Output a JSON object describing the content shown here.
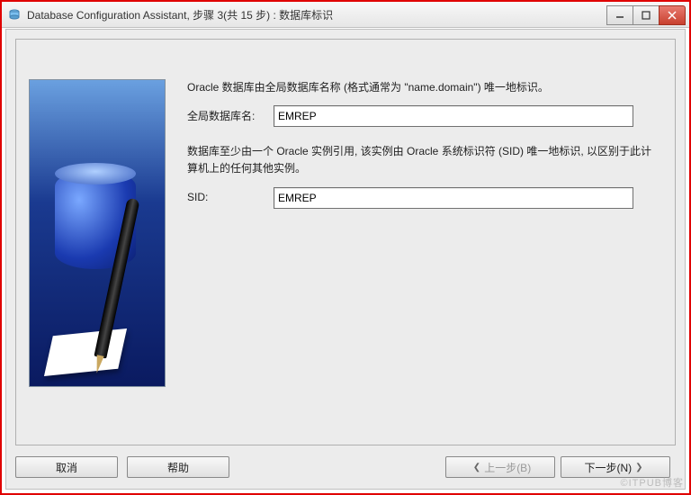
{
  "window": {
    "title": "Database Configuration Assistant, 步骤 3(共 15 步) : 数据库标识"
  },
  "description1": "Oracle 数据库由全局数据库名称 (格式通常为 \"name.domain\") 唯一地标识。",
  "globalDbLabel": "全局数据库名:",
  "globalDbValue": "EMREP",
  "description2": "数据库至少由一个 Oracle 实例引用, 该实例由 Oracle 系统标识符 (SID) 唯一地标识, 以区别于此计算机上的任何其他实例。",
  "sidLabel": "SID:",
  "sidValue": "EMREP",
  "buttons": {
    "cancel": "取消",
    "help": "帮助",
    "back": "上一步(B)",
    "next": "下一步(N)"
  },
  "watermark": "©ITPUB博客"
}
